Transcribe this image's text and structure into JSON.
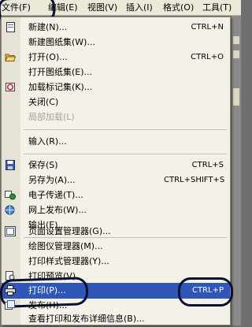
{
  "menubar": {
    "items": [
      {
        "label": "文件(F)"
      },
      {
        "label": "编辑(E)"
      },
      {
        "label": "视图(V)"
      },
      {
        "label": "插入(I)"
      },
      {
        "label": "格式(O)"
      },
      {
        "label": "工具(T)"
      }
    ],
    "active_index": 0
  },
  "menu": {
    "items": [
      {
        "label": "新建(N)...",
        "shortcut": "CTRL+N",
        "icon": "new-file-icon"
      },
      {
        "label": "新建图纸集(W)...",
        "shortcut": "",
        "icon": ""
      },
      {
        "label": "打开(O)...",
        "shortcut": "CTRL+O",
        "icon": "open-folder-icon"
      },
      {
        "label": "打开图纸集(E)...",
        "shortcut": "",
        "icon": ""
      },
      {
        "label": "加载标记集(K)...",
        "shortcut": "",
        "icon": "markup-set-icon"
      },
      {
        "label": "关闭(C)",
        "shortcut": "",
        "icon": ""
      },
      {
        "label": "局部加载(L)",
        "shortcut": "",
        "icon": "",
        "disabled": true
      },
      {
        "label": "输入(R)...",
        "shortcut": "",
        "icon": ""
      },
      {
        "label": "保存(S)",
        "shortcut": "CTRL+S",
        "icon": "save-icon"
      },
      {
        "label": "另存为(A)...",
        "shortcut": "CTRL+SHIFT+S",
        "icon": ""
      },
      {
        "label": "电子传递(T)...",
        "shortcut": "",
        "icon": "etransmit-icon"
      },
      {
        "label": "网上发布(W)...",
        "shortcut": "",
        "icon": "publish-web-icon"
      },
      {
        "label": "输出(E)...",
        "shortcut": "",
        "icon": ""
      },
      {
        "label": "页面设置管理器(G)...",
        "shortcut": "",
        "icon": "page-setup-icon"
      },
      {
        "label": "绘图仪管理器(M)...",
        "shortcut": "",
        "icon": ""
      },
      {
        "label": "打印样式管理器(Y)...",
        "shortcut": "",
        "icon": ""
      },
      {
        "label": "打印预览(V)",
        "shortcut": "",
        "icon": "print-preview-icon"
      },
      {
        "label": "打印(P)...",
        "shortcut": "CTRL+P",
        "icon": "print-icon",
        "highlighted": true
      },
      {
        "label": "发布(H)...",
        "shortcut": "",
        "icon": "publish-icon"
      },
      {
        "label": "查看打印和发布详细信息(B)...",
        "shortcut": "",
        "icon": ""
      }
    ]
  },
  "colors": {
    "highlight": "#2f57b8",
    "menu_background": "#f4f2e8",
    "menubar_background": "#ece9d8",
    "annotation_ink": "#0a1030"
  }
}
